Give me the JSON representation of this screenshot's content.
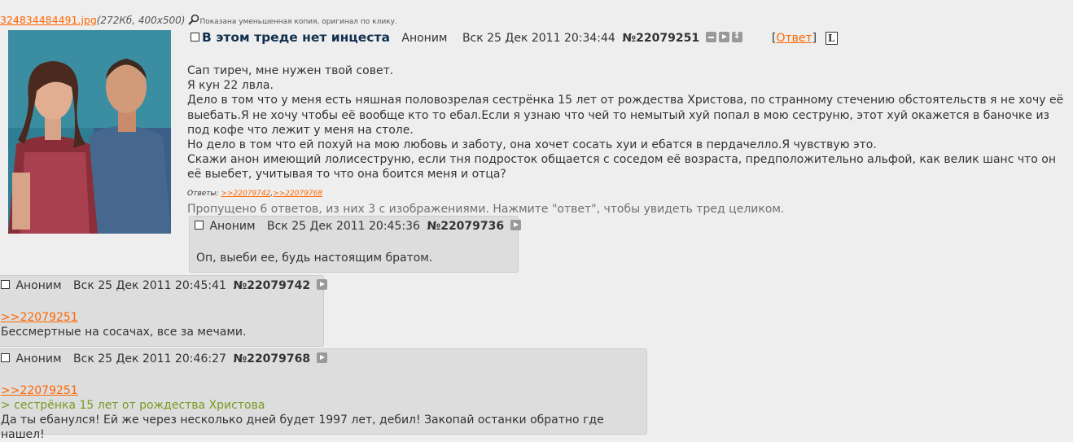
{
  "op": {
    "file": {
      "name": "324834484491.jpg",
      "meta": "(272Кб, 400x500)",
      "hint": "Показана уменьшенная копия, оригинал по клику."
    },
    "subject": "В этом треде нет инцеста",
    "poster": "Аноним",
    "date": "Вск 25 Дек 2011 20:34:44",
    "number": "№22079251",
    "reply_label": "Ответ",
    "lines": [
      "Сап тиреч, мне нужен твой совет.",
      "Я кун 22 лвла.",
      "Дело в том что у меня есть няшная половозрелая сестрёнка 15 лет от рождества Христова, по странному стечению обстоятельств я не хочу её выебать.Я не хочу чтобы её вообще кто то ебал.Если я узнаю что чей то немытый хуй попал в мою сеструню, этот хуй окажется в баночке из под кофе что лежит у меня на столе.",
      "Но дело в том что ей похуй на мою любовь и заботу, она хочет сосать хуи и ебатся в пердачелло.Я чувствую это.",
      "Скажи анон имеющий лолисеструню, если тня подросток общается с соседом её возраста, предположительно альфой, как велик шанс что он её выебет, учитывая то что она боится меня и отца?"
    ],
    "replies_label": "Ответы:",
    "reply_links": [
      ">>22079742",
      ">>22079768"
    ],
    "omitted": "Пропущено 6 ответов, из них 3 с изображениями. Нажмите \"ответ\", чтобы увидеть тред целиком."
  },
  "replies": [
    {
      "poster": "Аноним",
      "date": "Вск 25 Дек 2011 20:45:36",
      "number": "№22079736",
      "text": "Оп, выеби ее, будь настоящим братом."
    },
    {
      "poster": "Аноним",
      "date": "Вск 25 Дек 2011 20:45:41",
      "number": "№22079742",
      "quote_link": ">>22079251",
      "text": "Бессмертные на сосачах, все за мечами."
    },
    {
      "poster": "Аноним",
      "date": "Вск 25 Дек 2011 20:46:27",
      "number": "№22079768",
      "quote_link": ">>22079251",
      "greentext": "> сестрёнка 15 лет от рождества Христова",
      "text": "Да ты ебанулся! Ей же через несколько дней будет 1997 лет, дебил! Закопай останки обратно где нашел!"
    }
  ],
  "colors": {
    "background": "#eeeeee",
    "reply_background": "#dddddd",
    "link": "#ff6600",
    "subject": "#11304f",
    "greentext": "#789922"
  },
  "icons": [
    "magnifier-icon",
    "hide-icon",
    "reply-arrow-icon",
    "expand-icon",
    "l-badge-icon"
  ]
}
